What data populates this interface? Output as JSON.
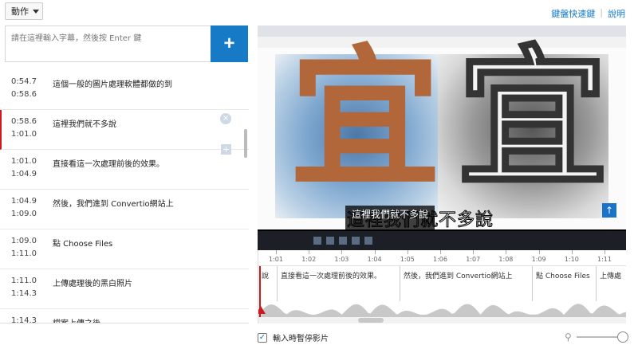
{
  "toolbar": {
    "actions_label": "動作"
  },
  "top_links": {
    "shortcuts": "鍵盤快速鍵",
    "separator": "|",
    "help": "說明"
  },
  "input": {
    "placeholder": "請在這裡輸入字幕，然後按 Enter 鍵",
    "add_label": "+"
  },
  "captions": [
    {
      "start": "0:54.7",
      "end": "0:58.6",
      "text": "這個一般的圖片處理軟體都做的到"
    },
    {
      "start": "0:58.6",
      "end": "1:01.0",
      "text": "這裡我們就不多說"
    },
    {
      "start": "1:01.0",
      "end": "1:04.9",
      "text": "直接看這一次處理前後的效果。"
    },
    {
      "start": "1:04.9",
      "end": "1:09.0",
      "text": "然後，我們進到 Convertio網站上"
    },
    {
      "start": "1:09.0",
      "end": "1:11.0",
      "text": "點 Choose Files"
    },
    {
      "start": "1:11.0",
      "end": "1:14.3",
      "text": "上傳處理後的黑白照片"
    },
    {
      "start": "1:14.3",
      "end": "",
      "text": "檔案上傳之後"
    }
  ],
  "active_caption_index": 1,
  "video": {
    "glyph": "宜",
    "burned_subtitle": "這裡我們就不多說",
    "overlay_subtitle": "這裡我們就不多說",
    "up_arrow": "↑"
  },
  "timeline": {
    "ticks": [
      "1:01",
      "1:02",
      "1:03",
      "1:04",
      "1:05",
      "1:06",
      "1:07",
      "1:08",
      "1:09",
      "1:10",
      "1:11"
    ],
    "segments": [
      "說",
      "直接看這一次處理前後的效果。",
      "然後，我們進到 Convertio網站上",
      "點 Choose Files",
      "上傳處"
    ]
  },
  "pause_option": {
    "label": "輸入時暫停影片",
    "checked": true,
    "check_mark": "✓"
  },
  "zoom": {
    "icon": "⚲",
    "level": 1.0
  },
  "colors": {
    "accent": "#167ac6",
    "active_marker": "#cc181e"
  }
}
